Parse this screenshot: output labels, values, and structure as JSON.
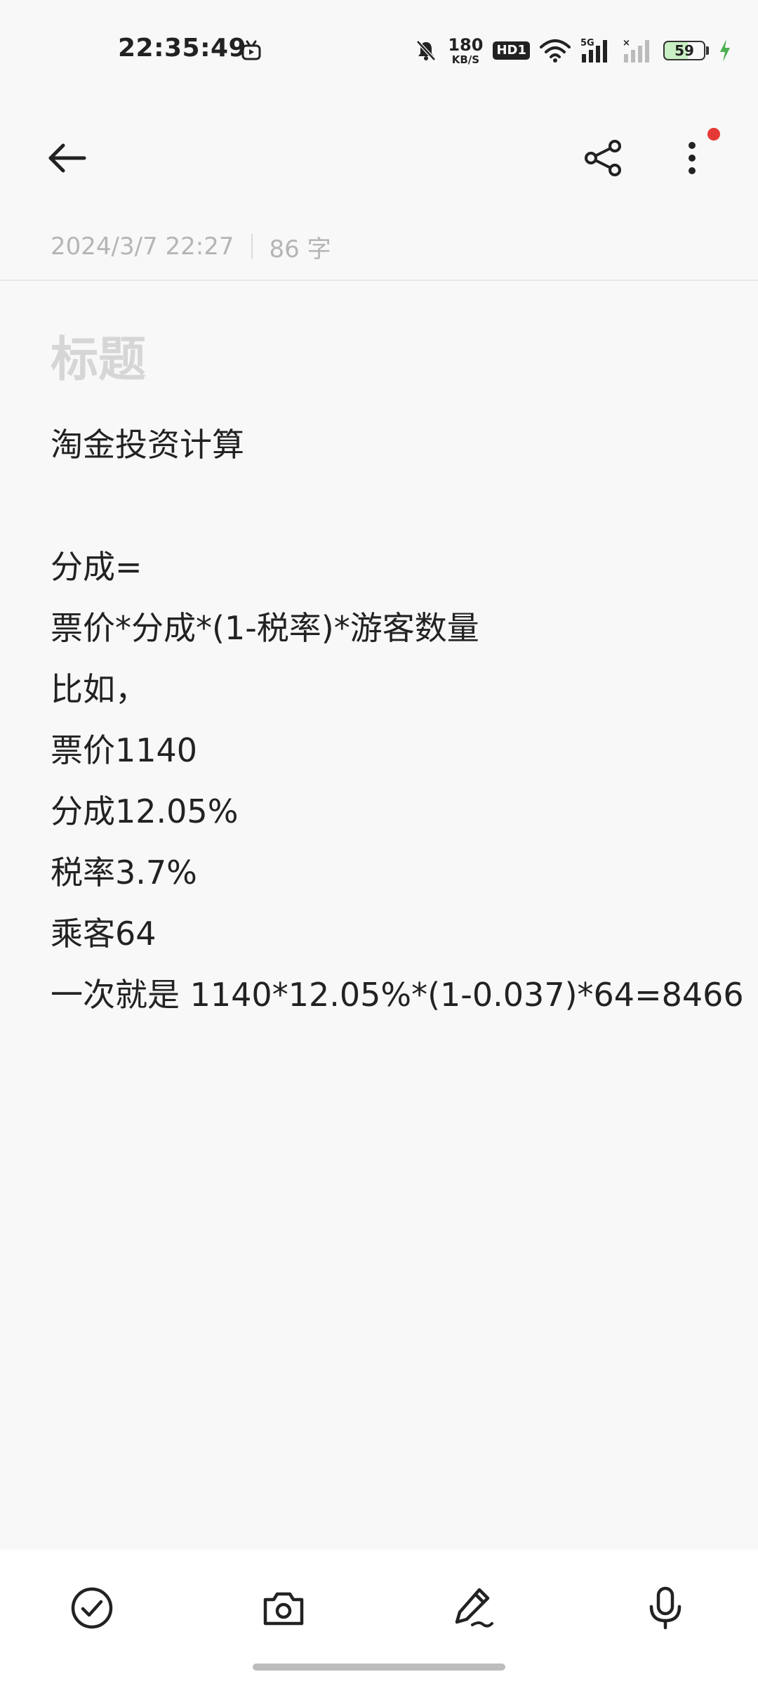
{
  "status_bar": {
    "time": "22:35:49",
    "net_speed_value": "180",
    "net_speed_unit": "KB/S",
    "hd_label": "HD1",
    "battery_level": "59",
    "icons": [
      "tv-icon",
      "mute-bell-icon",
      "wifi-icon",
      "5g-signal-icon",
      "no-signal-icon",
      "charging-icon"
    ]
  },
  "app_bar": {
    "icons": [
      "back-arrow-icon",
      "share-icon",
      "more-vertical-icon"
    ],
    "notification_dot_color": "#e53935"
  },
  "note": {
    "date": "2024/3/7 22:27",
    "word_count": "86 字",
    "title_placeholder": "标题",
    "lines": [
      "淘金投资计算",
      "",
      "分成=",
      "票价*分成*(1-税率)*游客数量",
      "比如，",
      "票价1140",
      "分成12.05%",
      "税率3.7%",
      "乘客64",
      "一次就是 1140*12.05%*(1-0.037)*64=8466"
    ]
  },
  "toolbar": {
    "icons": [
      "checklist-icon",
      "camera-icon",
      "pen-icon",
      "microphone-icon"
    ]
  }
}
